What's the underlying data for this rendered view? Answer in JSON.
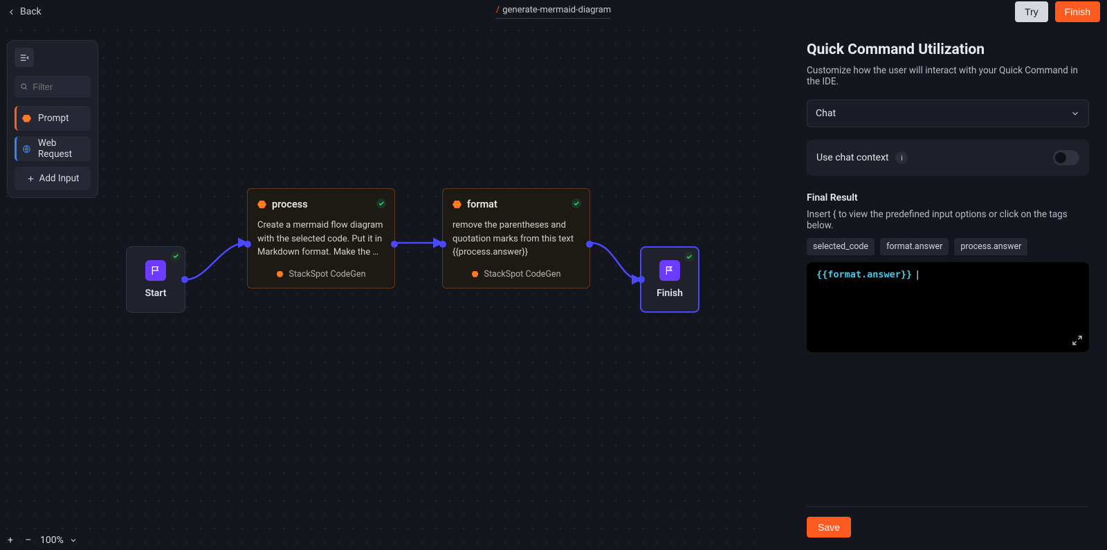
{
  "topbar": {
    "back": "Back",
    "breadcrumb_slash": "/",
    "breadcrumb_name": "generate-mermaid-diagram",
    "try": "Try",
    "finish": "Finish"
  },
  "palette": {
    "filter_placeholder": "Filter",
    "prompt": "Prompt",
    "web_request": "Web Request",
    "add_input": "Add Input"
  },
  "nodes": {
    "start": {
      "label": "Start"
    },
    "process": {
      "title": "process",
      "desc": "Create a mermaid flow diagram with the selected code. Put it in Markdown format. Make the …",
      "engine": "StackSpot CodeGen"
    },
    "format": {
      "title": "format",
      "desc": "remove the parentheses and quotation marks from this text {{process.answer}}",
      "engine": "StackSpot CodeGen"
    },
    "finish": {
      "label": "Finish"
    }
  },
  "zoom": {
    "level": "100%"
  },
  "panel": {
    "title": "Quick Command Utilization",
    "subtitle": "Customize how the user will interact with your Quick Command in the IDE.",
    "select_value": "Chat",
    "use_chat_context": "Use chat context",
    "final_result": "Final Result",
    "hint": "Insert { to view the predefined input options or click on the tags below.",
    "tags": [
      "selected_code",
      "format.answer",
      "process.answer"
    ],
    "editor_value": "{{format.answer}}",
    "save": "Save"
  }
}
